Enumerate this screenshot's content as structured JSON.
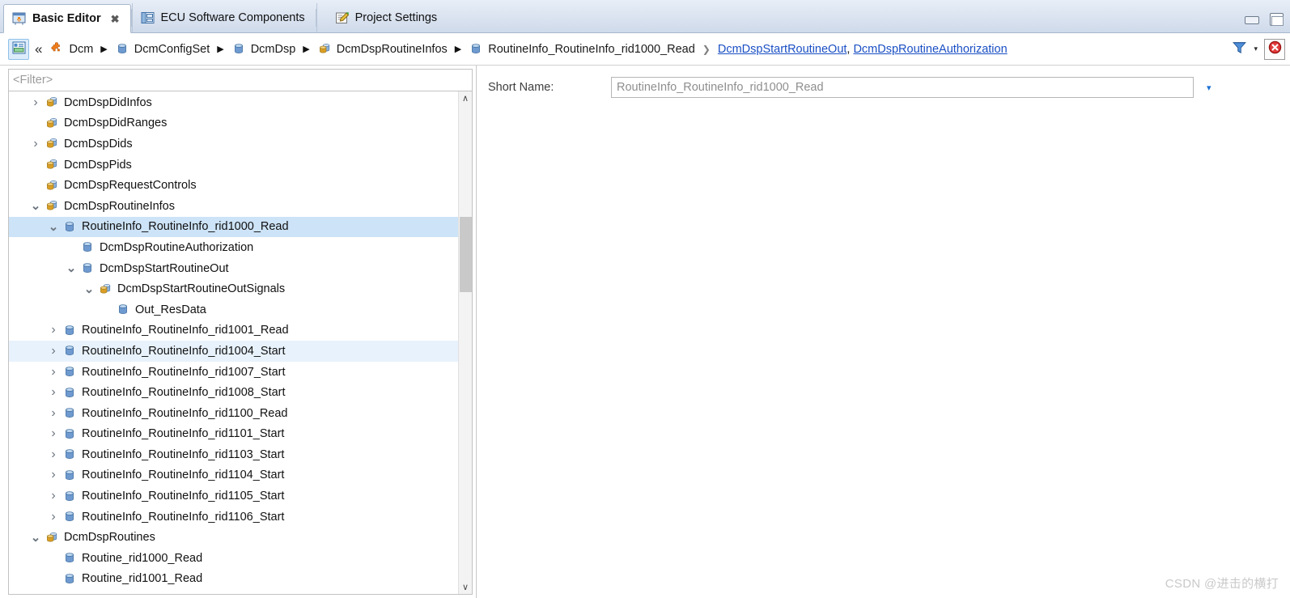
{
  "window": {
    "minimize_label": "Minimize",
    "maximize_label": "Maximize"
  },
  "tabs": [
    {
      "label": "Basic Editor",
      "icon": "basic-editor-icon",
      "active": true,
      "closable": true,
      "close_glyph": "✖"
    },
    {
      "label": "ECU Software Components",
      "icon": "ecu-software-components-icon",
      "active": false,
      "closable": false
    },
    {
      "label": "Project Settings",
      "icon": "project-settings-icon",
      "active": false,
      "closable": false
    }
  ],
  "breadcrumb": {
    "form_button_icon": "form-view-icon",
    "collapse_glyph": "«",
    "separator_glyph": "▶",
    "thin_separator_glyph": "❯",
    "items": [
      {
        "label": "Dcm",
        "icon": "module-puzzle-icon"
      },
      {
        "label": "DcmConfigSet",
        "icon": "container-icon"
      },
      {
        "label": "DcmDsp",
        "icon": "container-icon"
      },
      {
        "label": "DcmDspRoutineInfos",
        "icon": "container-list-icon"
      },
      {
        "label": "RoutineInfo_RoutineInfo_rid1000_Read",
        "icon": "container-icon"
      }
    ],
    "links": [
      "DcmDspStartRoutineOut",
      "DcmDspRoutineAuthorization"
    ],
    "link_separator": ",",
    "filter_icon": "filter-funnel-icon",
    "filter_caret_glyph": "▾",
    "error_icon": "error-close-icon"
  },
  "tree_panel": {
    "filter_placeholder": "<Filter>",
    "expand_glyph": "›",
    "collapse_glyph": "⌄",
    "scroll_up_glyph": "∧",
    "scroll_down_glyph": "∨",
    "rows": [
      {
        "label": "DcmDspDidInfos",
        "indent": 2,
        "icon": "container-list-icon",
        "twisty": "collapsed",
        "state": "normal"
      },
      {
        "label": "DcmDspDidRanges",
        "indent": 2,
        "icon": "container-list-icon",
        "twisty": "none",
        "state": "normal"
      },
      {
        "label": "DcmDspDids",
        "indent": 2,
        "icon": "container-list-icon",
        "twisty": "collapsed",
        "state": "normal"
      },
      {
        "label": "DcmDspPids",
        "indent": 2,
        "icon": "container-list-icon",
        "twisty": "none",
        "state": "normal"
      },
      {
        "label": "DcmDspRequestControls",
        "indent": 2,
        "icon": "container-list-icon",
        "twisty": "none",
        "state": "normal"
      },
      {
        "label": "DcmDspRoutineInfos",
        "indent": 2,
        "icon": "container-list-icon",
        "twisty": "expanded",
        "state": "normal"
      },
      {
        "label": "RoutineInfo_RoutineInfo_rid1000_Read",
        "indent": 3,
        "icon": "container-icon",
        "twisty": "expanded",
        "state": "selected"
      },
      {
        "label": "DcmDspRoutineAuthorization",
        "indent": 4,
        "icon": "container-icon",
        "twisty": "none",
        "state": "normal"
      },
      {
        "label": "DcmDspStartRoutineOut",
        "indent": 4,
        "icon": "container-icon",
        "twisty": "expanded",
        "state": "normal"
      },
      {
        "label": "DcmDspStartRoutineOutSignals",
        "indent": 5,
        "icon": "container-list-icon",
        "twisty": "expanded",
        "state": "normal"
      },
      {
        "label": "Out_ResData",
        "indent": 6,
        "icon": "container-icon",
        "twisty": "none",
        "state": "normal"
      },
      {
        "label": "RoutineInfo_RoutineInfo_rid1001_Read",
        "indent": 3,
        "icon": "container-icon",
        "twisty": "collapsed",
        "state": "normal"
      },
      {
        "label": "RoutineInfo_RoutineInfo_rid1004_Start",
        "indent": 3,
        "icon": "container-icon",
        "twisty": "collapsed",
        "state": "hovered"
      },
      {
        "label": "RoutineInfo_RoutineInfo_rid1007_Start",
        "indent": 3,
        "icon": "container-icon",
        "twisty": "collapsed",
        "state": "normal"
      },
      {
        "label": "RoutineInfo_RoutineInfo_rid1008_Start",
        "indent": 3,
        "icon": "container-icon",
        "twisty": "collapsed",
        "state": "normal"
      },
      {
        "label": "RoutineInfo_RoutineInfo_rid1100_Read",
        "indent": 3,
        "icon": "container-icon",
        "twisty": "collapsed",
        "state": "normal"
      },
      {
        "label": "RoutineInfo_RoutineInfo_rid1101_Start",
        "indent": 3,
        "icon": "container-icon",
        "twisty": "collapsed",
        "state": "normal"
      },
      {
        "label": "RoutineInfo_RoutineInfo_rid1103_Start",
        "indent": 3,
        "icon": "container-icon",
        "twisty": "collapsed",
        "state": "normal"
      },
      {
        "label": "RoutineInfo_RoutineInfo_rid1104_Start",
        "indent": 3,
        "icon": "container-icon",
        "twisty": "collapsed",
        "state": "normal"
      },
      {
        "label": "RoutineInfo_RoutineInfo_rid1105_Start",
        "indent": 3,
        "icon": "container-icon",
        "twisty": "collapsed",
        "state": "normal"
      },
      {
        "label": "RoutineInfo_RoutineInfo_rid1106_Start",
        "indent": 3,
        "icon": "container-icon",
        "twisty": "collapsed",
        "state": "normal"
      },
      {
        "label": "DcmDspRoutines",
        "indent": 2,
        "icon": "container-list-icon",
        "twisty": "expanded",
        "state": "normal"
      },
      {
        "label": "Routine_rid1000_Read",
        "indent": 3,
        "icon": "container-icon",
        "twisty": "none",
        "state": "normal"
      },
      {
        "label": "Routine_rid1001_Read",
        "indent": 3,
        "icon": "container-icon",
        "twisty": "none",
        "state": "normal"
      }
    ]
  },
  "detail": {
    "short_name_label": "Short Name:",
    "short_name_value": "RoutineInfo_RoutineInfo_rid1000_Read",
    "dropdown_glyph": "▾"
  },
  "watermark": "CSDN @进击的横打",
  "colors": {
    "selection": "#cde3f7",
    "hover": "#e8f2fc",
    "link": "#1a4fc4",
    "tab_bar": "#dae3f0",
    "container_icon_blue": "#6f9ad0",
    "container_list_icon_gold": "#d9a52c"
  }
}
